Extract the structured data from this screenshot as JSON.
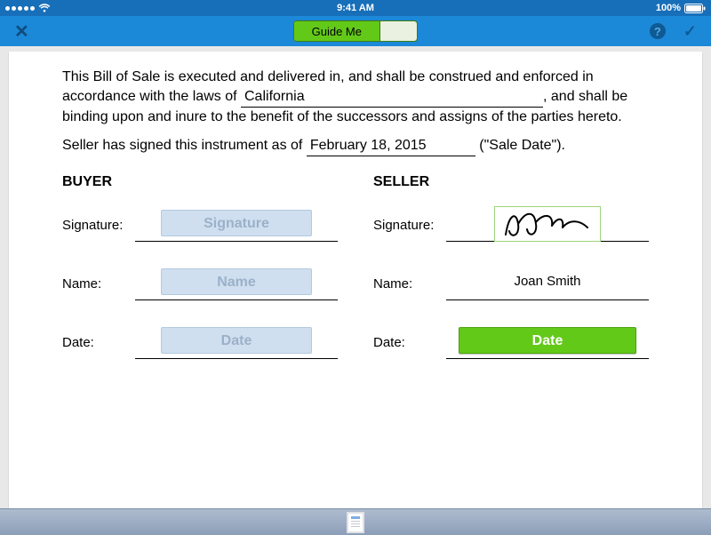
{
  "status": {
    "time": "9:41 AM",
    "battery": "100%"
  },
  "topbar": {
    "guide_label": "Guide Me"
  },
  "document": {
    "para1_a": "This Bill of Sale is executed and delivered in, and shall be construed and enforced in accordance with the laws of ",
    "state_value": "California",
    "para1_b": ", and shall be binding upon and inure to the benefit of the successors and assigns of the parties hereto.",
    "para2_a": "Seller has signed this instrument as of ",
    "sale_date_value": "February 18, 2015",
    "para2_b": "  (\"Sale Date\").",
    "buyer_heading": "BUYER",
    "seller_heading": "SELLER",
    "labels": {
      "signature": "Signature:",
      "name": "Name:",
      "date": "Date:"
    },
    "buttons": {
      "signature": "Signature",
      "name": "Name",
      "date": "Date"
    },
    "seller": {
      "name_value": "Joan Smith"
    }
  }
}
